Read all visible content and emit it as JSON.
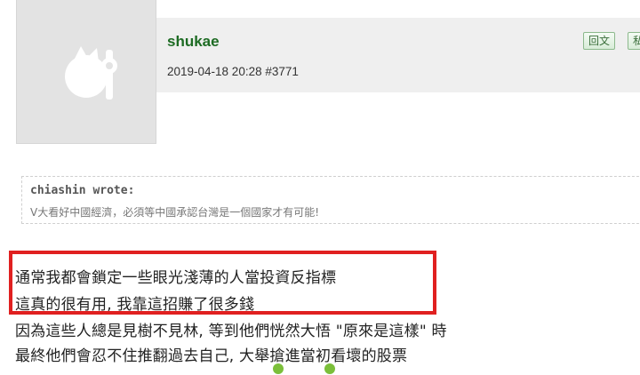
{
  "post": {
    "username": "shukae",
    "meta": "2019-04-18 20:28  #3771",
    "reply_label": "回文",
    "more_label": "私"
  },
  "quote": {
    "author": "chiashin wrote:",
    "text": "V大看好中國經濟，必須等中國承認台灣是一個國家才有可能!"
  },
  "content": {
    "lines": [
      "通常我都會鎖定一些眼光淺薄的人當投資反指標",
      "這真的很有用, 我靠這招賺了很多錢",
      "因為這些人總是見樹不見林, 等到他們恍然大悟 \"原來是這樣\" 時",
      "最終他們會忍不住推翻過去自己, 大舉搶進當初看壞的股票"
    ]
  },
  "colors": {
    "username": "#1d6b23",
    "highlight_border": "#e02020",
    "header_bg": "#efefef",
    "avatar_bg": "#e3e3e3"
  }
}
